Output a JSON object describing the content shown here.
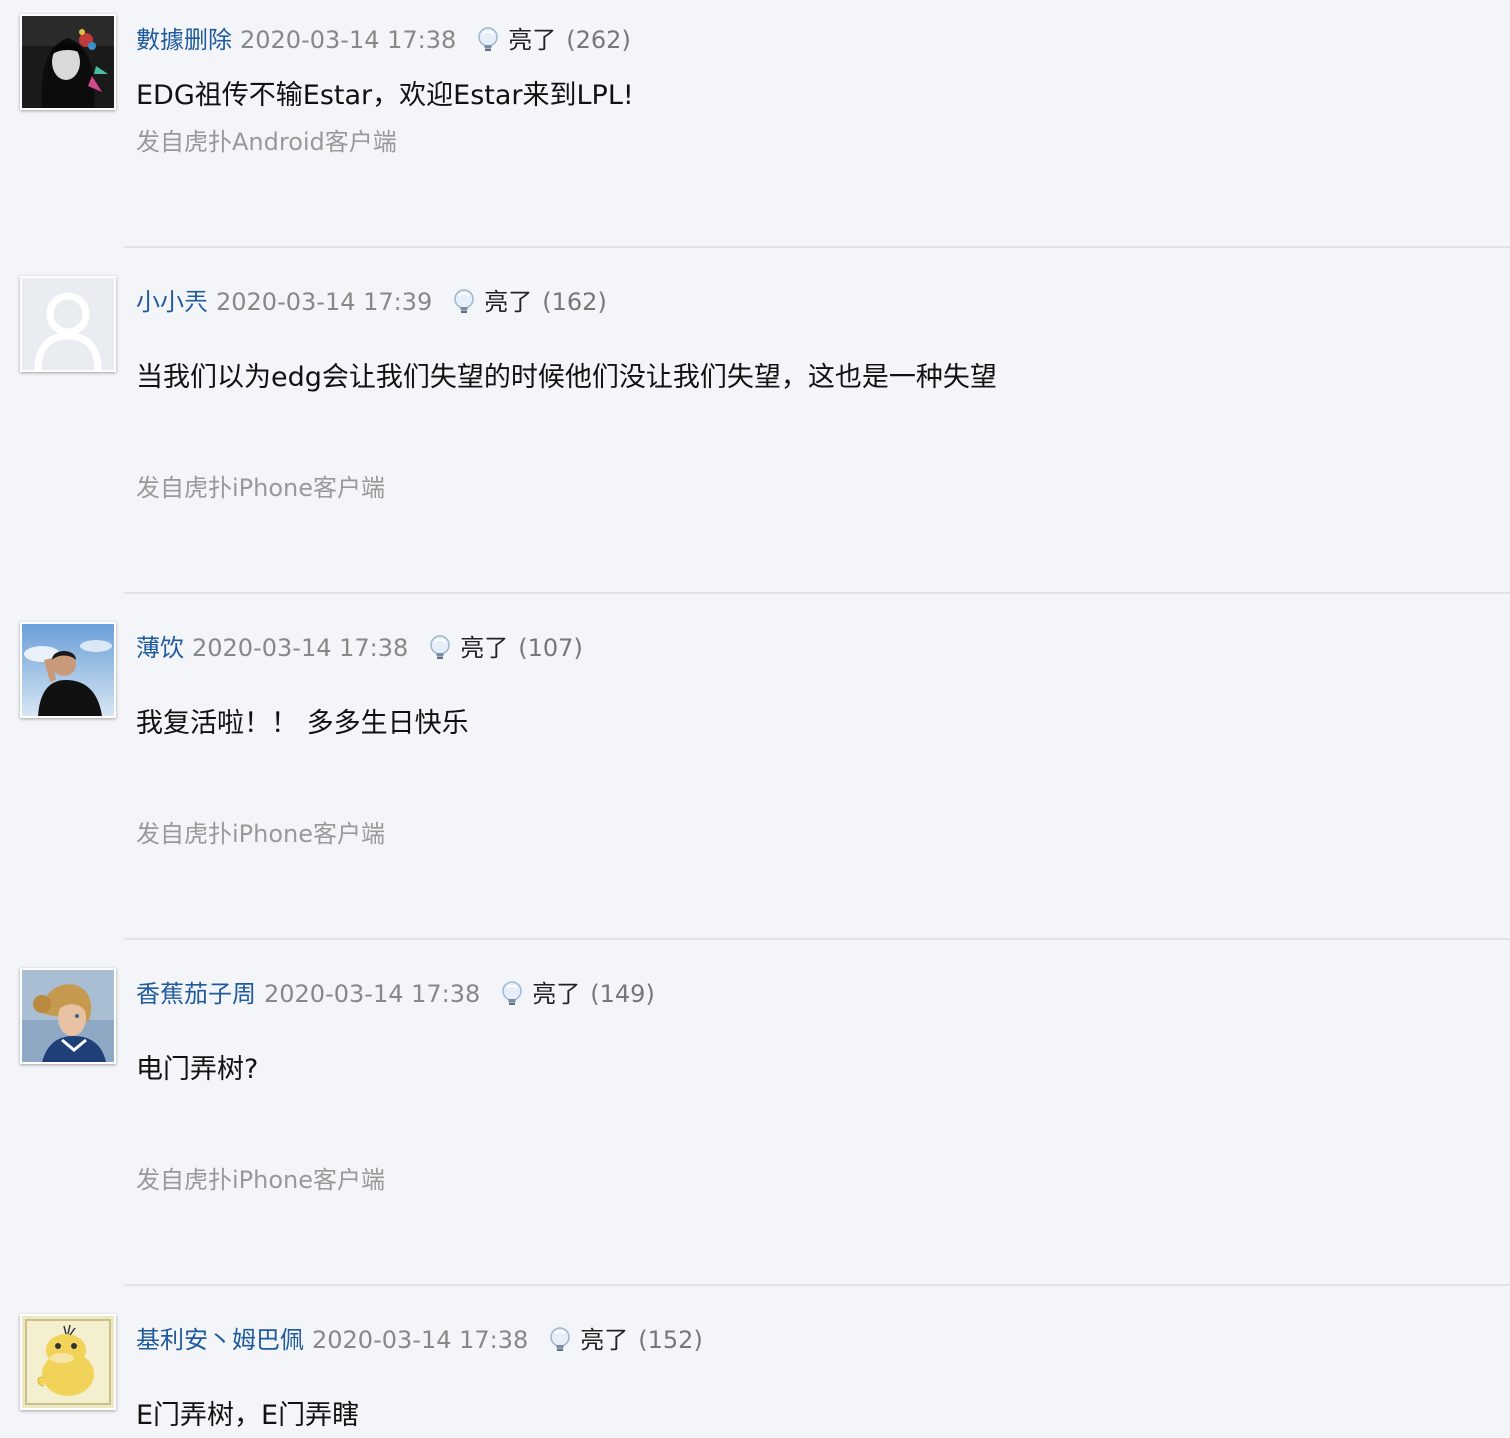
{
  "posts": [
    {
      "username": "數據删除",
      "time": "2020-03-14 17:38",
      "light_label": "亮了",
      "light_count": "(262)",
      "content": "EDG祖传不输Estar，欢迎Estar来到LPL!",
      "source": "发自虎扑Android客户端",
      "avatar_icon": "dark-anime-portrait"
    },
    {
      "username": "小小兲",
      "time": "2020-03-14 17:39",
      "light_label": "亮了",
      "light_count": "(162)",
      "content": "当我们以为edg会让我们失望的时候他们没让我们失望，这也是一种失望",
      "source": "发自虎扑iPhone客户端",
      "avatar_icon": "default-user-icon"
    },
    {
      "username": "薄饮",
      "time": "2020-03-14 17:38",
      "light_label": "亮了",
      "light_count": "(107)",
      "content": "我复活啦！！ 多多生日快乐",
      "source": "发自虎扑iPhone客户端",
      "avatar_icon": "person-sky-photo"
    },
    {
      "username": "香蕉茄子周",
      "time": "2020-03-14 17:38",
      "light_label": "亮了",
      "light_count": "(149)",
      "content": "电门弄树?",
      "source": "发自虎扑iPhone客户端",
      "avatar_icon": "blonde-character-portrait"
    },
    {
      "username": "基利安丶姆巴佩",
      "time": "2020-03-14 17:38",
      "light_label": "亮了",
      "light_count": "(152)",
      "content": "E门弄树，E门弄瞎",
      "source": "",
      "avatar_icon": "yellow-duck-cartoon"
    }
  ],
  "colors": {
    "background": "#f3f5f8",
    "username": "#1f5a9e",
    "muted": "#999999",
    "divider": "#dfe4ec"
  }
}
